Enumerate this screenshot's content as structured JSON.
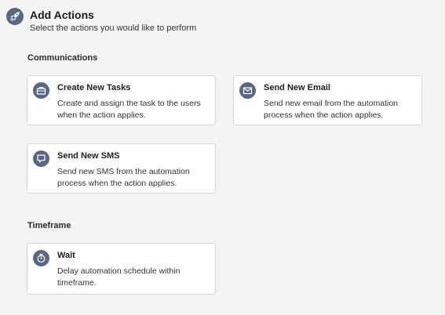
{
  "header": {
    "title": "Add Actions",
    "subtitle": "Select the actions you would like to perform",
    "icon": "rocket-icon"
  },
  "sections": [
    {
      "title": "Communications",
      "cards": [
        {
          "title": "Create New Tasks",
          "description": "Create and assign the task to the users when the action applies.",
          "icon": "briefcase-icon"
        },
        {
          "title": "Send New Email",
          "description": "Send new email from the automation process when the action applies.",
          "icon": "email-icon"
        },
        {
          "title": "Send New SMS",
          "description": "Send new SMS from the automation process when the action applies.",
          "icon": "sms-icon"
        }
      ]
    },
    {
      "title": "Timeframe",
      "cards": [
        {
          "title": "Wait",
          "description": "Delay automation schedule within timeframe.",
          "icon": "stopwatch-icon"
        }
      ]
    }
  ],
  "colors": {
    "background": "#f4f4f4",
    "icon_bg": "#5a6781",
    "card_border": "#d6d6d6"
  }
}
